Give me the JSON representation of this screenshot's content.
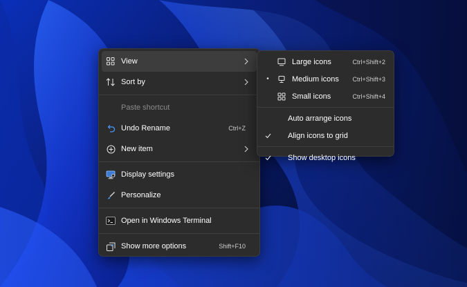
{
  "colors": {
    "menu_bg": "#2c2c2c",
    "active_bg": "#3d3d3d",
    "text": "#ffffff",
    "disabled_text": "#8b8b8b",
    "accent_blue": "#4c9bff"
  },
  "context_menu": {
    "view": {
      "label": "View",
      "icon": "grid-icon"
    },
    "sort_by": {
      "label": "Sort by",
      "icon": "sort-icon"
    },
    "paste_shortcut": {
      "label": "Paste shortcut"
    },
    "undo_rename": {
      "label": "Undo Rename",
      "shortcut": "Ctrl+Z",
      "icon": "undo-icon"
    },
    "new_item": {
      "label": "New item",
      "icon": "add-circle-icon"
    },
    "display_settings": {
      "label": "Display settings",
      "icon": "display-icon"
    },
    "personalize": {
      "label": "Personalize",
      "icon": "brush-icon"
    },
    "open_terminal": {
      "label": "Open in Windows Terminal",
      "icon": "terminal-icon"
    },
    "show_more": {
      "label": "Show more options",
      "shortcut": "Shift+F10",
      "icon": "more-options-icon"
    }
  },
  "view_submenu": {
    "large_icons": {
      "label": "Large icons",
      "shortcut": "Ctrl+Shift+2",
      "icon": "monitor-large-icon"
    },
    "medium_icons": {
      "label": "Medium icons",
      "shortcut": "Ctrl+Shift+3",
      "icon": "monitor-medium-icon",
      "selected": true
    },
    "small_icons": {
      "label": "Small icons",
      "shortcut": "Ctrl+Shift+4",
      "icon": "small-grid-icon"
    },
    "auto_arrange": {
      "label": "Auto arrange icons",
      "checked": false
    },
    "align_grid": {
      "label": "Align icons to grid",
      "checked": true
    },
    "show_desktop_icons": {
      "label": "Show desktop icons",
      "checked": true
    }
  }
}
